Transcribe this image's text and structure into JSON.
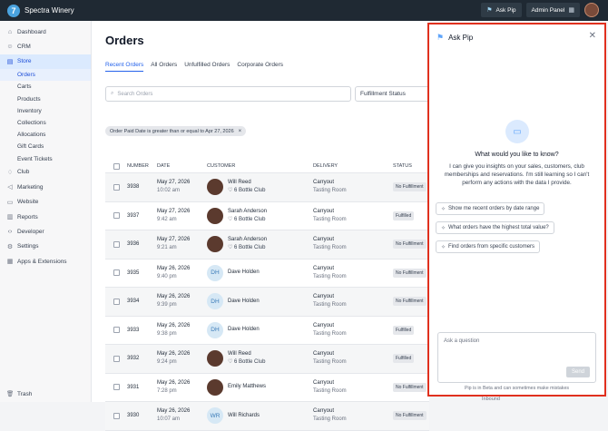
{
  "app": {
    "name": "Spectra Winery",
    "logo_glyph": "7"
  },
  "topbar": {
    "ask_pip": "Ask Pip",
    "admin_panel": "Admin Panel"
  },
  "sidebar": {
    "items": [
      {
        "label": "Dashboard",
        "icon": "home-icon"
      },
      {
        "label": "CRM",
        "icon": "users-icon"
      },
      {
        "label": "Store",
        "icon": "store-icon",
        "active": true
      },
      {
        "label": "Club",
        "icon": "club-icon"
      },
      {
        "label": "Marketing",
        "icon": "megaphone-icon"
      },
      {
        "label": "Website",
        "icon": "monitor-icon"
      },
      {
        "label": "Reports",
        "icon": "chart-icon"
      },
      {
        "label": "Developer",
        "icon": "code-icon"
      },
      {
        "label": "Settings",
        "icon": "gear-icon"
      },
      {
        "label": "Apps & Extensions",
        "icon": "grid-icon"
      }
    ],
    "store_sub": [
      "Orders",
      "Carts",
      "Products",
      "Inventory",
      "Collections",
      "Allocations",
      "Gift Cards",
      "Event Tickets"
    ],
    "trash": "Trash"
  },
  "main": {
    "title": "Orders",
    "tabs": [
      "Recent Orders",
      "All Orders",
      "Unfulfilled Orders",
      "Corporate Orders"
    ],
    "search_placeholder": "Search Orders",
    "fulfillment_status": "Fulfillment Status",
    "filter_chip": "Order Paid Date is greater than or equal to Apr 27, 2026",
    "columns": [
      "NUMBER",
      "DATE",
      "CUSTOMER",
      "DELIVERY",
      "STATUS"
    ],
    "rows": [
      {
        "number": "3938",
        "date": "May 27, 2026",
        "time": "10:02 am",
        "customer": "Will Reed",
        "club": "6 Bottle Club",
        "initials": "",
        "delivery": "Carryout",
        "location": "Tasting Room",
        "status": "No Fulfillment"
      },
      {
        "number": "3937",
        "date": "May 27, 2026",
        "time": "9:42 am",
        "customer": "Sarah Anderson",
        "club": "6 Bottle Club",
        "initials": "",
        "delivery": "Carryout",
        "location": "Tasting Room",
        "status": "Fulfilled"
      },
      {
        "number": "3936",
        "date": "May 27, 2026",
        "time": "9:21 am",
        "customer": "Sarah Anderson",
        "club": "6 Bottle Club",
        "initials": "",
        "delivery": "Carryout",
        "location": "Tasting Room",
        "status": "No Fulfillment"
      },
      {
        "number": "3935",
        "date": "May 26, 2026",
        "time": "9:40 pm",
        "customer": "Dave Holden",
        "club": "",
        "initials": "DH",
        "delivery": "Carryout",
        "location": "Tasting Room",
        "status": "No Fulfillment"
      },
      {
        "number": "3934",
        "date": "May 26, 2026",
        "time": "9:39 pm",
        "customer": "Dave Holden",
        "club": "",
        "initials": "DH",
        "delivery": "Carryout",
        "location": "Tasting Room",
        "status": "No Fulfillment"
      },
      {
        "number": "3933",
        "date": "May 26, 2026",
        "time": "9:38 pm",
        "customer": "Dave Holden",
        "club": "",
        "initials": "DH",
        "delivery": "Carryout",
        "location": "Tasting Room",
        "status": "Fulfilled"
      },
      {
        "number": "3932",
        "date": "May 26, 2026",
        "time": "9:24 pm",
        "customer": "Will Reed",
        "club": "6 Bottle Club",
        "initials": "",
        "delivery": "Carryout",
        "location": "Tasting Room",
        "status": "Fulfilled"
      },
      {
        "number": "3931",
        "date": "May 26, 2026",
        "time": "7:28 pm",
        "customer": "Emily Matthews",
        "club": "",
        "initials": "",
        "delivery": "Carryout",
        "location": "Tasting Room",
        "status": "No Fulfillment"
      },
      {
        "number": "3930",
        "date": "May 26, 2026",
        "time": "10:07 am",
        "customer": "Will Richards",
        "club": "",
        "initials": "WR",
        "delivery": "Carryout",
        "location": "Tasting Room",
        "status": "No Fulfillment"
      }
    ],
    "inbound": "Inbound"
  },
  "pip": {
    "title": "Ask Pip",
    "heading": "What would you like to know?",
    "description": "I can give you insights on your sales, customers, club memberships and reservations. I'm still learning so I can't perform any actions with the data I provide.",
    "suggestions": [
      "Show me recent orders by date range",
      "What orders have the highest total value?",
      "Find orders from specific customers"
    ],
    "input_placeholder": "Ask a question",
    "send": "Send",
    "footer": "Pip is in Beta and can sometimes make mistakes"
  }
}
